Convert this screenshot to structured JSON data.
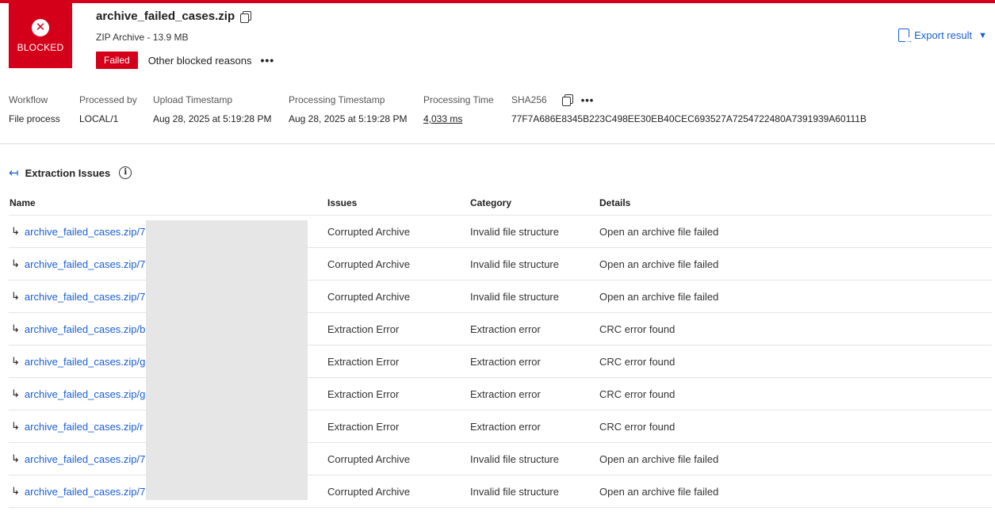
{
  "colors": {
    "accent": "#1a5fd6",
    "danger": "#d4001a",
    "text": "#1f1f1f"
  },
  "header": {
    "status_tile_label": "BLOCKED",
    "status_icon": "x-circle-icon",
    "file_name": "archive_failed_cases.zip",
    "file_meta": "ZIP Archive - 13.9 MB",
    "status_badge": "Failed",
    "reason_text": "Other blocked reasons",
    "more_icon": "ellipsis-icon",
    "export_label": "Export result"
  },
  "meta": {
    "workflow": {
      "label": "Workflow",
      "value": "File process"
    },
    "processed_by": {
      "label": "Processed by",
      "value": "LOCAL/1"
    },
    "upload_ts": {
      "label": "Upload Timestamp",
      "value": "Aug 28, 2025 at 5:19:28 PM"
    },
    "processing_ts": {
      "label": "Processing Timestamp",
      "value": "Aug 28, 2025 at 5:19:28 PM"
    },
    "processing_time": {
      "label": "Processing Time",
      "value": "4,033 ms"
    },
    "sha256": {
      "label": "SHA256",
      "value": "77F7A686E8345B223C498EE30EB40CEC693527A7254722480A7391939A60111B"
    }
  },
  "section": {
    "title": "Extraction Issues"
  },
  "table": {
    "headers": {
      "name": "Name",
      "issues": "Issues",
      "category": "Category",
      "details": "Details"
    },
    "rows": [
      {
        "name": "archive_failed_cases.zip/7",
        "issue": "Corrupted Archive",
        "category": "Invalid file structure",
        "details": "Open an archive file failed"
      },
      {
        "name": "archive_failed_cases.zip/7",
        "issue": "Corrupted Archive",
        "category": "Invalid file structure",
        "details": "Open an archive file failed"
      },
      {
        "name": "archive_failed_cases.zip/7",
        "issue": "Corrupted Archive",
        "category": "Invalid file structure",
        "details": "Open an archive file failed"
      },
      {
        "name": "archive_failed_cases.zip/b",
        "issue": "Extraction Error",
        "category": "Extraction error",
        "details": "CRC error found"
      },
      {
        "name": "archive_failed_cases.zip/g",
        "issue": "Extraction Error",
        "category": "Extraction error",
        "details": "CRC error found"
      },
      {
        "name": "archive_failed_cases.zip/g",
        "issue": "Extraction Error",
        "category": "Extraction error",
        "details": "CRC error found"
      },
      {
        "name": "archive_failed_cases.zip/r",
        "issue": "Extraction Error",
        "category": "Extraction error",
        "details": "CRC error found"
      },
      {
        "name": "archive_failed_cases.zip/7",
        "issue": "Corrupted Archive",
        "category": "Invalid file structure",
        "details": "Open an archive file failed"
      },
      {
        "name": "archive_failed_cases.zip/7",
        "issue": "Corrupted Archive",
        "category": "Invalid file structure",
        "details": "Open an archive file failed"
      }
    ]
  }
}
